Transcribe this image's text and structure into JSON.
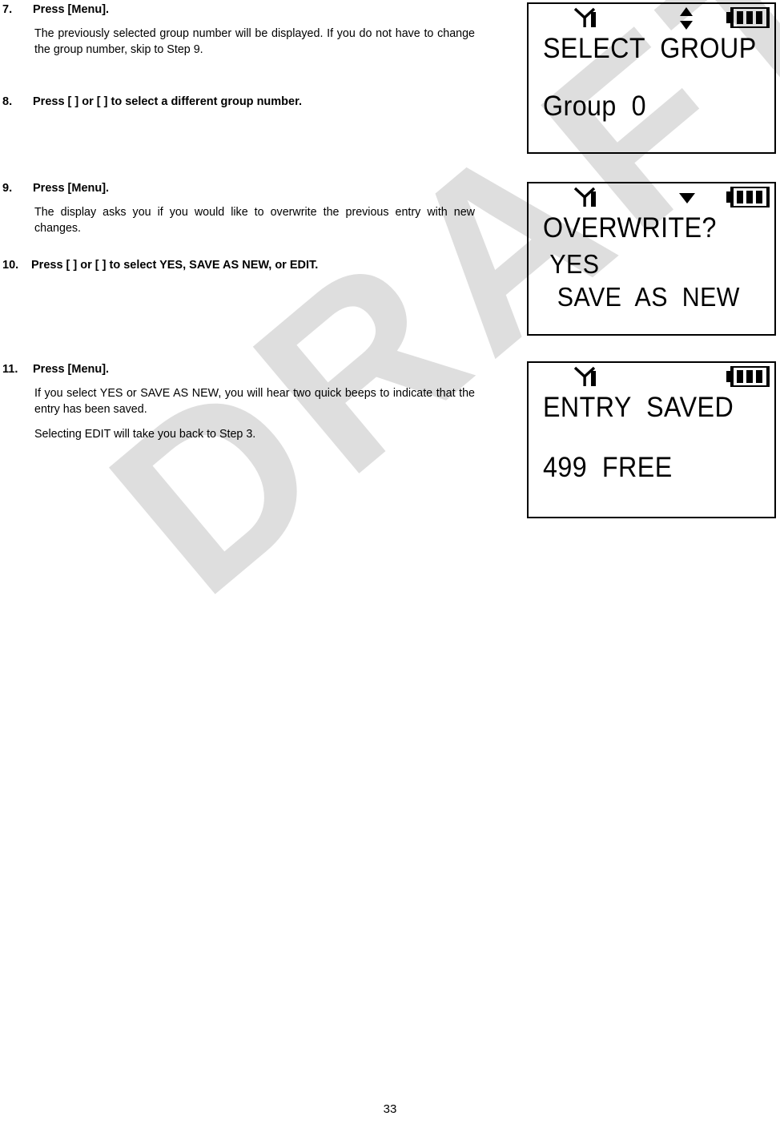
{
  "page": {
    "number": "33",
    "watermark": "DRAFT",
    "watermark_color": "#dedede"
  },
  "steps": [
    {
      "number": "7.",
      "title": "Press [Menu].",
      "paragraphs": [
        "The previously selected group number will be displayed. If you do not have to change the group number, skip to Step 9."
      ]
    },
    {
      "number": "8.",
      "title": "Press [   ] or [   ] to select a different group number.",
      "paragraphs": []
    },
    {
      "number": "9.",
      "title": "Press [Menu].",
      "paragraphs": [
        "The display asks you if you would like to overwrite the previous entry with new changes."
      ]
    },
    {
      "number": "10.",
      "title": "Press  [   ]  or  [   ]  to  select  YES,  SAVE  AS  NEW,  or EDIT.",
      "paragraphs": []
    },
    {
      "number": "11.",
      "title": "Press [Menu].",
      "paragraphs": [
        "If you select YES or SAVE AS NEW, you will hear two quick beeps to indicate that the entry has been saved.",
        "Selecting EDIT will take you back to Step 3."
      ]
    }
  ],
  "displays": [
    {
      "name": "select-group",
      "status_icons": {
        "signal": "antenna-signal-icon",
        "middle": "up-down-arrows-icon",
        "battery": "battery-full-icon"
      },
      "lines": [
        "SELECT  GROUP",
        "Group  0"
      ]
    },
    {
      "name": "overwrite-prompt",
      "status_icons": {
        "signal": "antenna-signal-icon",
        "middle": "down-arrow-icon",
        "battery": "battery-full-icon"
      },
      "lines": [
        "OVERWRITE?",
        " YES",
        "  SAVE  AS  NEW"
      ]
    },
    {
      "name": "entry-saved",
      "status_icons": {
        "signal": "antenna-signal-icon",
        "middle": "none",
        "battery": "battery-full-icon"
      },
      "lines": [
        "ENTRY  SAVED",
        "499  FREE"
      ]
    }
  ]
}
